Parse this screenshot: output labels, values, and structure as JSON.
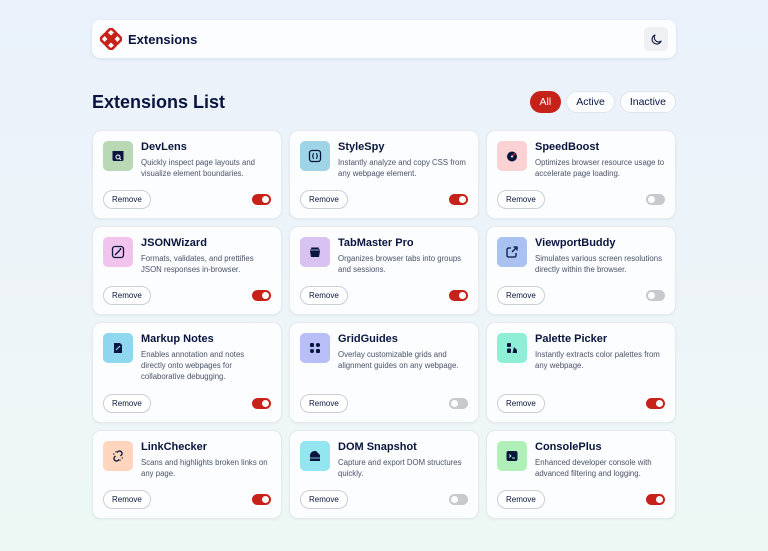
{
  "header": {
    "brand_name": "Extensions",
    "theme_icon": "moon-icon",
    "logo_color": "#c7221a"
  },
  "toolbar": {
    "title": "Extensions List",
    "filters": [
      "All",
      "Active",
      "Inactive"
    ],
    "selected_filter": "All"
  },
  "colors": {
    "accent": "#c7221a",
    "text": "#09153e",
    "toggle_off": "#c7c9cf"
  },
  "extensions": [
    {
      "name": "DevLens",
      "description": "Quickly inspect page layouts and visualize element boundaries.",
      "active": true,
      "icon": "inspect-window-icon",
      "icon_bg": "#b9d8b4",
      "remove_label": "Remove"
    },
    {
      "name": "StyleSpy",
      "description": "Instantly analyze and copy CSS from any webpage element.",
      "active": true,
      "icon": "css-braces-icon",
      "icon_bg": "#9fd3e6",
      "remove_label": "Remove"
    },
    {
      "name": "SpeedBoost",
      "description": "Optimizes browser resource usage to accelerate page loading.",
      "active": false,
      "icon": "speedometer-icon",
      "icon_bg": "#fbd2d4",
      "remove_label": "Remove"
    },
    {
      "name": "JSONWizard",
      "description": "Formats, validates, and prettifies JSON responses in-browser.",
      "active": true,
      "icon": "magic-wand-icon",
      "icon_bg": "#f2c3ec",
      "remove_label": "Remove"
    },
    {
      "name": "TabMaster Pro",
      "description": "Organizes browser tabs into groups and sessions.",
      "active": true,
      "icon": "tab-stack-icon",
      "icon_bg": "#d7c2f2",
      "remove_label": "Remove"
    },
    {
      "name": "ViewportBuddy",
      "description": "Simulates various screen resolutions directly within the browser.",
      "active": false,
      "icon": "resize-arrow-icon",
      "icon_bg": "#a9c2f2",
      "remove_label": "Remove"
    },
    {
      "name": "Markup Notes",
      "description": "Enables annotation and notes directly onto webpages for collaborative debugging.",
      "active": true,
      "icon": "note-pen-icon",
      "icon_bg": "#8fd6ef",
      "remove_label": "Remove"
    },
    {
      "name": "GridGuides",
      "description": "Overlay customizable grids and alignment guides on any webpage.",
      "active": false,
      "icon": "grid-dots-icon",
      "icon_bg": "#b8bff7",
      "remove_label": "Remove"
    },
    {
      "name": "Palette Picker",
      "description": "Instantly extracts color palettes from any webpage.",
      "active": true,
      "icon": "palette-icon",
      "icon_bg": "#8eeed6",
      "remove_label": "Remove"
    },
    {
      "name": "LinkChecker",
      "description": "Scans and highlights broken links on any page.",
      "active": true,
      "icon": "broken-link-icon",
      "icon_bg": "#ffd5bd",
      "remove_label": "Remove"
    },
    {
      "name": "DOM Snapshot",
      "description": "Capture and export DOM structures quickly.",
      "active": false,
      "icon": "snapshot-icon",
      "icon_bg": "#93e6ef",
      "remove_label": "Remove"
    },
    {
      "name": "ConsolePlus",
      "description": "Enhanced developer console with advanced filtering and logging.",
      "active": true,
      "icon": "terminal-icon",
      "icon_bg": "#b0f0b8",
      "remove_label": "Remove"
    }
  ]
}
